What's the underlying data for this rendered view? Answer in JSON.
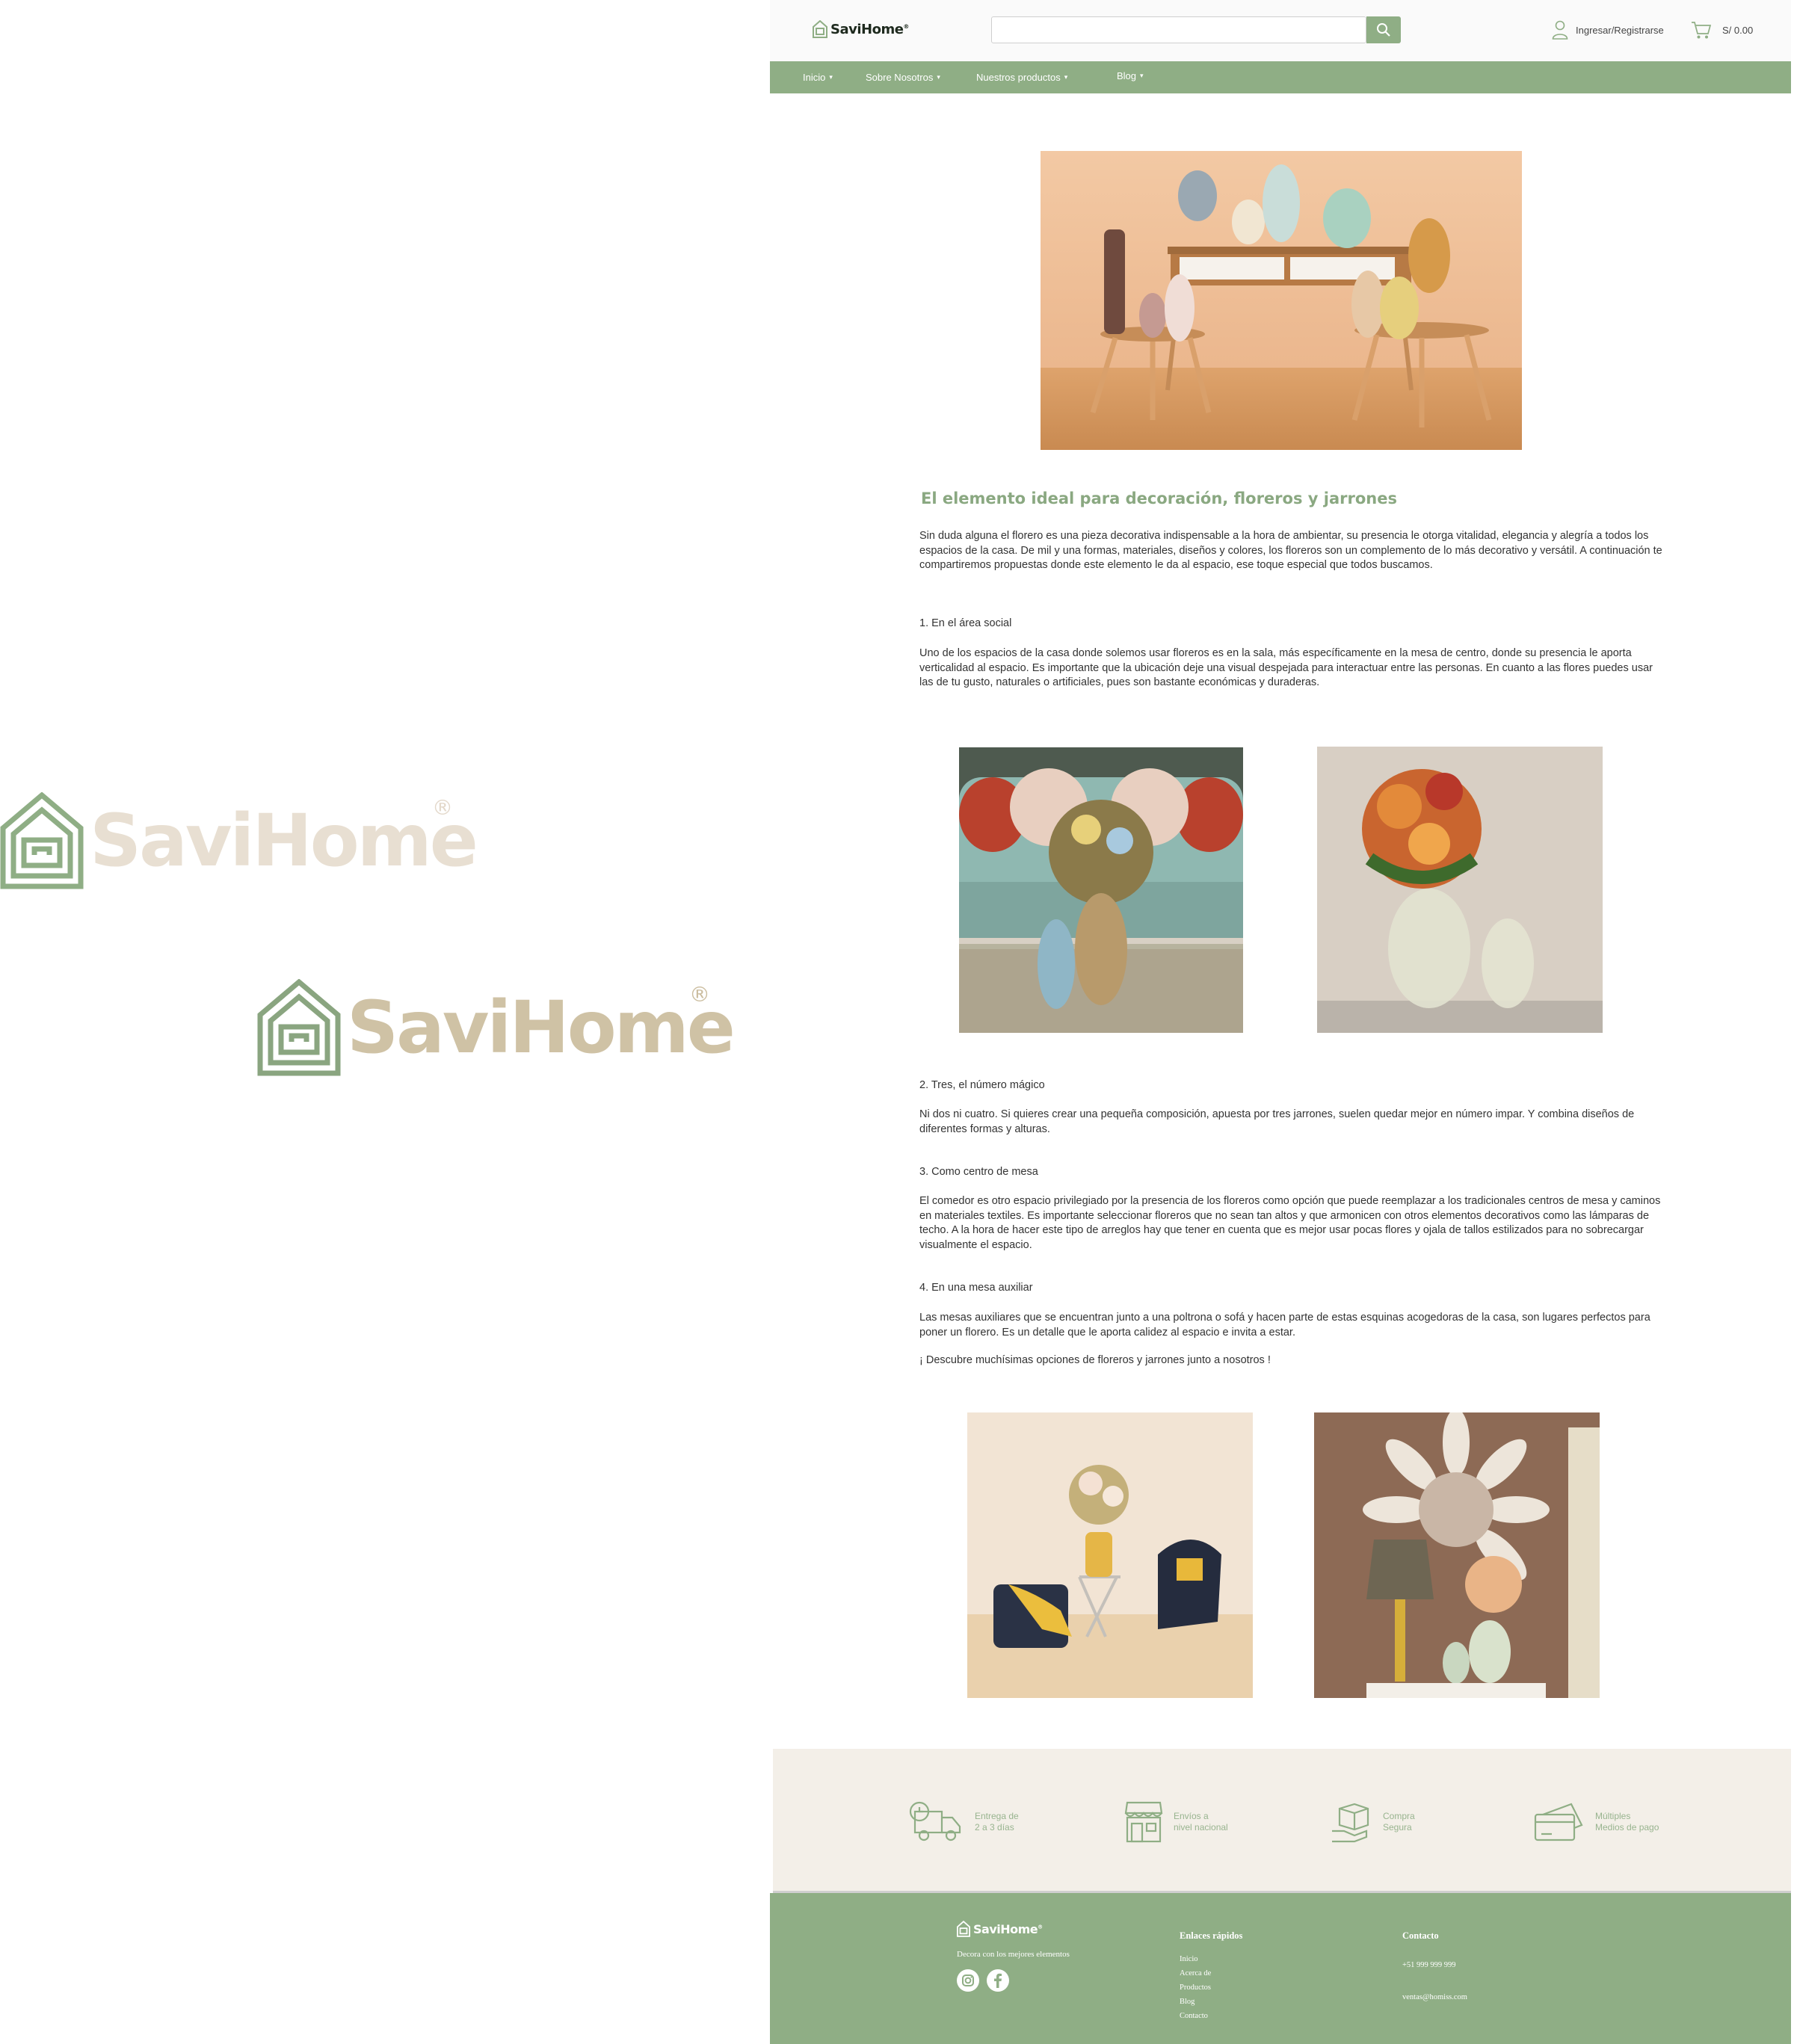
{
  "side_logos": [
    {
      "wordmark": "SaviHome",
      "registered": "®"
    },
    {
      "wordmark": "SaviHome",
      "registered": "®"
    }
  ],
  "header": {
    "brand": "SaviHome",
    "brand_reg": "®",
    "search": {
      "value": "",
      "placeholder": ""
    },
    "search_icon": "search-icon",
    "account_label": "Ingresar/Registrarse",
    "account_icon": "user-icon",
    "cart_total": "S/ 0.00",
    "cart_icon": "cart-icon"
  },
  "nav": [
    {
      "label": "Inicio"
    },
    {
      "label": "Sobre Nosotros"
    },
    {
      "label": "Nuestros productos"
    },
    {
      "label": "Blog"
    }
  ],
  "article": {
    "title": "El elemento ideal para decoración, floreros y jarrones",
    "intro": "Sin duda alguna el florero es una pieza decorativa indispensable a la hora de ambientar, su presencia le otorga vitalidad, elegancia y alegría a todos los espacios de la casa. De mil y una formas, materiales, diseños y colores, los floreros son un complemento de lo más decorativo y versátil. A continuación te compartiremos propuestas donde este elemento le da al espacio, ese toque especial que todos buscamos.",
    "sections": [
      {
        "heading": "1.  En el área social",
        "text": "Uno de los espacios de la casa donde solemos usar floreros es en la sala, más específicamente en la mesa de centro, donde su presencia le aporta verticalidad al espacio. Es importante que la ubicación deje una visual despejada para interactuar entre las personas. En cuanto a las flores puedes usar las de tu gusto, naturales o artificiales, pues son bastante económicas y duraderas."
      },
      {
        "heading": "2. Tres, el número mágico",
        "text": "Ni dos ni cuatro. Si quieres crear una pequeña composición, apuesta por tres jarrones, suelen quedar mejor en número impar. Y combina diseños de diferentes formas y alturas."
      },
      {
        "heading": "3. Como centro de mesa",
        "text": "El comedor es otro espacio privilegiado por la presencia de los floreros como opción que puede reemplazar a los tradicionales centros de mesa y caminos en materiales textiles. Es importante seleccionar floreros que no sean tan altos y que armonicen con otros elementos decorativos como las lámparas de techo. A la hora de hacer este tipo de arreglos hay que tener en cuenta que es mejor usar pocas flores y ojala de tallos estilizados para no sobrecargar visualmente el espacio."
      },
      {
        "heading": "4. En una mesa auxiliar",
        "text": "Las mesas auxiliares que se encuentran junto a una poltrona o sofá y hacen parte de estas esquinas acogedoras de la casa, son lugares perfectos para poner un florero. Es un detalle que le aporta calidez al espacio e invita a estar."
      }
    ],
    "closing": "¡ Descubre muchísimas opciones de floreros y jarrones junto a nosotros !"
  },
  "features": [
    {
      "label": "Entrega de\n2 a 3 días",
      "icon": "delivery-truck-icon"
    },
    {
      "label": "Envíos a\nnivel nacional",
      "icon": "store-icon"
    },
    {
      "label": "Compra\nSegura",
      "icon": "secure-box-icon"
    },
    {
      "label": "Múltiples\nMedios de pago",
      "icon": "credit-card-icon"
    }
  ],
  "footer": {
    "brand": "SaviHome",
    "brand_reg": "®",
    "tagline": "Decora con los mejores elementos",
    "social": [
      "instagram-icon",
      "facebook-icon"
    ],
    "links_heading": "Enlaces rápidos",
    "links": [
      "Inicio",
      "Acerca de",
      "Productos",
      "Blog",
      "Contacto"
    ],
    "contact_heading": "Contacto",
    "phone": "+51 999 999 999",
    "email": "ventas@homiss.com"
  },
  "colors": {
    "accent": "#8fae85",
    "footer_band": "#f3efe8",
    "logo_light": "#e8dfd2",
    "logo_tan": "#cfc2a5"
  }
}
